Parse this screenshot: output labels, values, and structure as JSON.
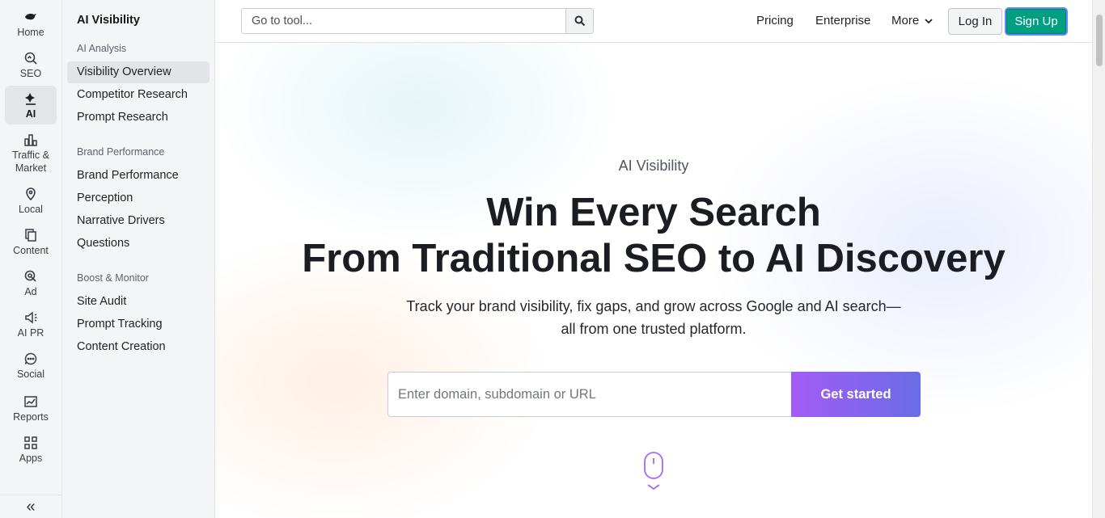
{
  "rail": {
    "items": [
      {
        "label": "Home",
        "icon": "home-icon"
      },
      {
        "label": "SEO",
        "icon": "seo-icon"
      },
      {
        "label": "AI",
        "icon": "ai-icon",
        "active": true
      },
      {
        "label": "Traffic &\nMarket",
        "icon": "traffic-market-icon"
      },
      {
        "label": "Local",
        "icon": "location-pin-icon"
      },
      {
        "label": "Content",
        "icon": "content-icon"
      },
      {
        "label": "Ad",
        "icon": "ad-icon"
      },
      {
        "label": "AI PR",
        "icon": "ai-pr-icon"
      },
      {
        "label": "Social",
        "icon": "social-icon"
      },
      {
        "label": "Reports",
        "icon": "reports-icon"
      },
      {
        "label": "Apps",
        "icon": "apps-icon"
      }
    ],
    "collapse_glyph": "«"
  },
  "sidebar": {
    "title": "AI Visibility",
    "groups": [
      {
        "label": "AI Analysis",
        "items": [
          "Visibility Overview",
          "Competitor Research",
          "Prompt Research"
        ]
      },
      {
        "label": "Brand Performance",
        "items": [
          "Brand Performance",
          "Perception",
          "Narrative Drivers",
          "Questions"
        ]
      },
      {
        "label": "Boost & Monitor",
        "items": [
          "Site Audit",
          "Prompt Tracking",
          "Content Creation"
        ]
      }
    ],
    "active_item": "Visibility Overview"
  },
  "topbar": {
    "search_placeholder": "Go to tool...",
    "nav": {
      "pricing": "Pricing",
      "enterprise": "Enterprise",
      "more": "More"
    },
    "login": "Log In",
    "signup": "Sign Up"
  },
  "hero": {
    "eyebrow": "AI Visibility",
    "headline_line1": "Win Every Search",
    "headline_line2": "From Traditional SEO to AI Discovery",
    "sub_line1": "Track your brand visibility, fix gaps, and grow across Google and AI search—",
    "sub_line2": "all from one trusted platform.",
    "domain_placeholder": "Enter domain, subdomain or URL",
    "cta": "Get started"
  },
  "colors": {
    "signup_bg": "#009f81",
    "signup_border": "#5b8cff",
    "cta_gradient_start": "#a25cf5",
    "cta_gradient_end": "#6a6ce6",
    "scroll_hint_icon": "#a46af0"
  }
}
